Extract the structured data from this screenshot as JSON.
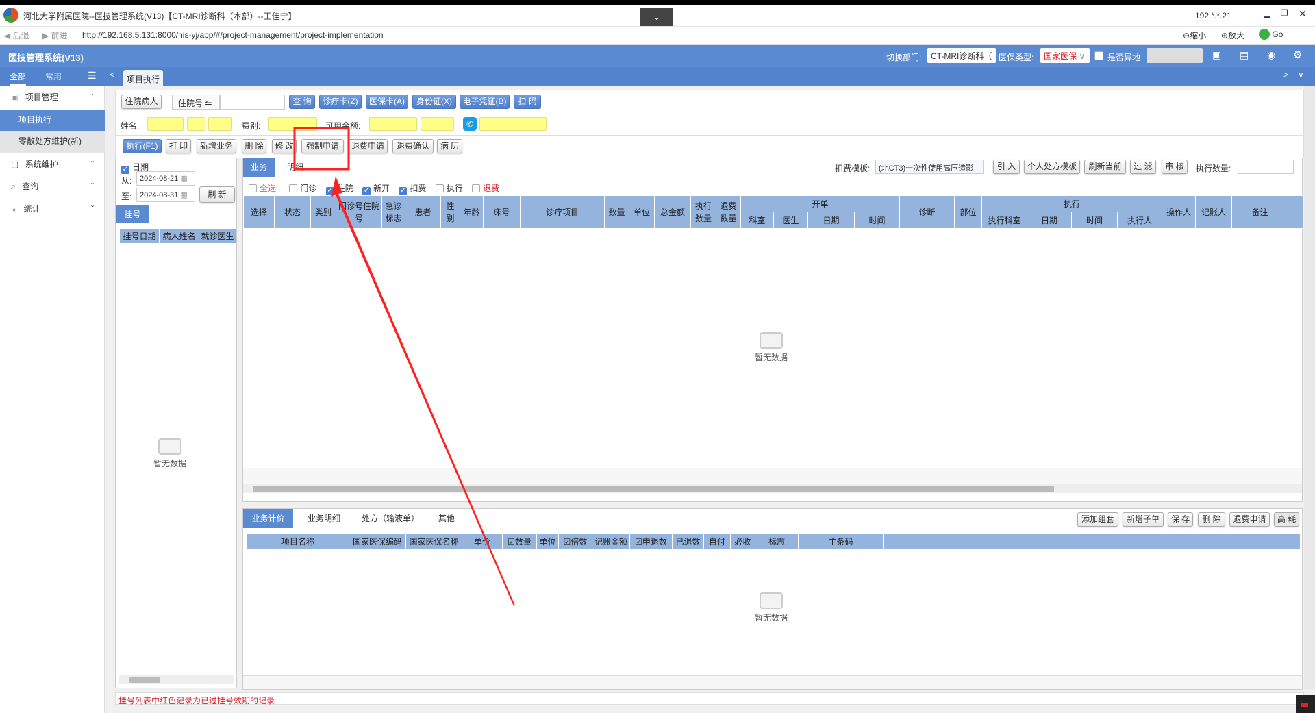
{
  "window": {
    "title": "河北大学附属医院--医技管理系统(V13)【CT-MRI诊断科（本部）--王佳宁】",
    "ip": "192.*.*.21"
  },
  "browser": {
    "back": "后退",
    "forward": "前进",
    "url": "http://192.168.5.131:8000/his-yj/app/#/project-management/project-implementation",
    "zoom_out": "缩小",
    "zoom_in": "放大",
    "go": "Go"
  },
  "header": {
    "app_title": "医技管理系统(V13)",
    "dept_label": "切换部门:",
    "dept_value": "CT-MRI诊断科（",
    "ins_label": "医保类型:",
    "ins_value": "国家医保",
    "remote_label": "是否异地"
  },
  "sidebar": {
    "tabs": [
      "全部",
      "常用"
    ],
    "items": [
      {
        "label": "项目管理"
      },
      {
        "label": "项目执行"
      },
      {
        "label": "零散处方维护(新)"
      },
      {
        "label": "系统维护"
      },
      {
        "label": "查询"
      },
      {
        "label": "统计"
      }
    ]
  },
  "page_tab": "项目执行",
  "search": {
    "patient_btn": "住院病人",
    "id_type": "住院号 ⇋",
    "buttons": [
      "查 询",
      "诊疗卡(Z)",
      "医保卡(A)",
      "身份证(X)",
      "电子凭证(B)",
      "扫 码"
    ]
  },
  "info": {
    "name_label": "姓名:",
    "fee_label": "费别:",
    "balance_label": "可用余额:"
  },
  "actions": [
    "执行(F1)",
    "打 印",
    "新增业务",
    "删 除",
    "修 改",
    "强制申请",
    "退费申请",
    "退费确认",
    "病 历"
  ],
  "left": {
    "date_label": "日期",
    "from_label": "从:",
    "from": "2024-08-21",
    "to_label": "至:",
    "to": "2024-08-31",
    "refresh": "刷 新",
    "tab": "挂号",
    "cols": [
      "挂号日期",
      "病人姓名",
      "就诊医生"
    ],
    "empty": "暂无数据",
    "note": "挂号列表中红色记录为已过挂号效期的记录"
  },
  "main": {
    "tabs": [
      "业务",
      "明细"
    ],
    "template_label": "扣费模板:",
    "template_value": "(北CT3)一次性使用高压造影",
    "buttons": [
      "引 入",
      "个人处方模板",
      "刷新当前",
      "过 滤",
      "审 核"
    ],
    "exec_qty_label": "执行数量:",
    "filters": [
      {
        "label": "全选",
        "checked": false,
        "red": true
      },
      {
        "label": "门诊",
        "checked": false
      },
      {
        "label": "住院",
        "checked": true
      },
      {
        "label": "新开",
        "checked": true
      },
      {
        "label": "扣费",
        "checked": true
      },
      {
        "label": "执行",
        "checked": false
      },
      {
        "label": "退费",
        "checked": false,
        "red": true
      }
    ],
    "cols": [
      "选择",
      "状态",
      "类别",
      "门诊号住院号",
      "急诊标志",
      "患者",
      "性别",
      "年龄",
      "床号",
      "诊疗项目",
      "数量",
      "单位",
      "总金额",
      "执行数量",
      "退费数量"
    ],
    "group_open": "开单",
    "open_cols": [
      "科室",
      "医生",
      "日期",
      "时间"
    ],
    "diag": "诊断",
    "part": "部位",
    "group_exec": "执行",
    "exec_cols": [
      "执行科室",
      "日期",
      "时间",
      "执行人"
    ],
    "tail_cols": [
      "操作人",
      "记账人",
      "备注"
    ],
    "empty": "暂无数据"
  },
  "bottom": {
    "tabs": [
      "业务计价",
      "业务明细",
      "处方（输液单）",
      "其他"
    ],
    "buttons": [
      "添加组套",
      "新增子单",
      "保 存",
      "删 除",
      "退费申请",
      "高 耗"
    ],
    "cols": [
      "项目名称",
      "国家医保编码",
      "国家医保名称",
      "单价",
      "☑数量",
      "单位",
      "☑倍数",
      "记账金额",
      "☑申退数",
      "已退数",
      "自付",
      "必收",
      "标志",
      "主条码"
    ],
    "empty": "暂无数据"
  },
  "colors": {
    "accent": "#5a8bd2",
    "header_cell": "#94b3dd",
    "highlight": "#ffff88",
    "annotation": "#ff2020",
    "danger": "#d9232e"
  }
}
